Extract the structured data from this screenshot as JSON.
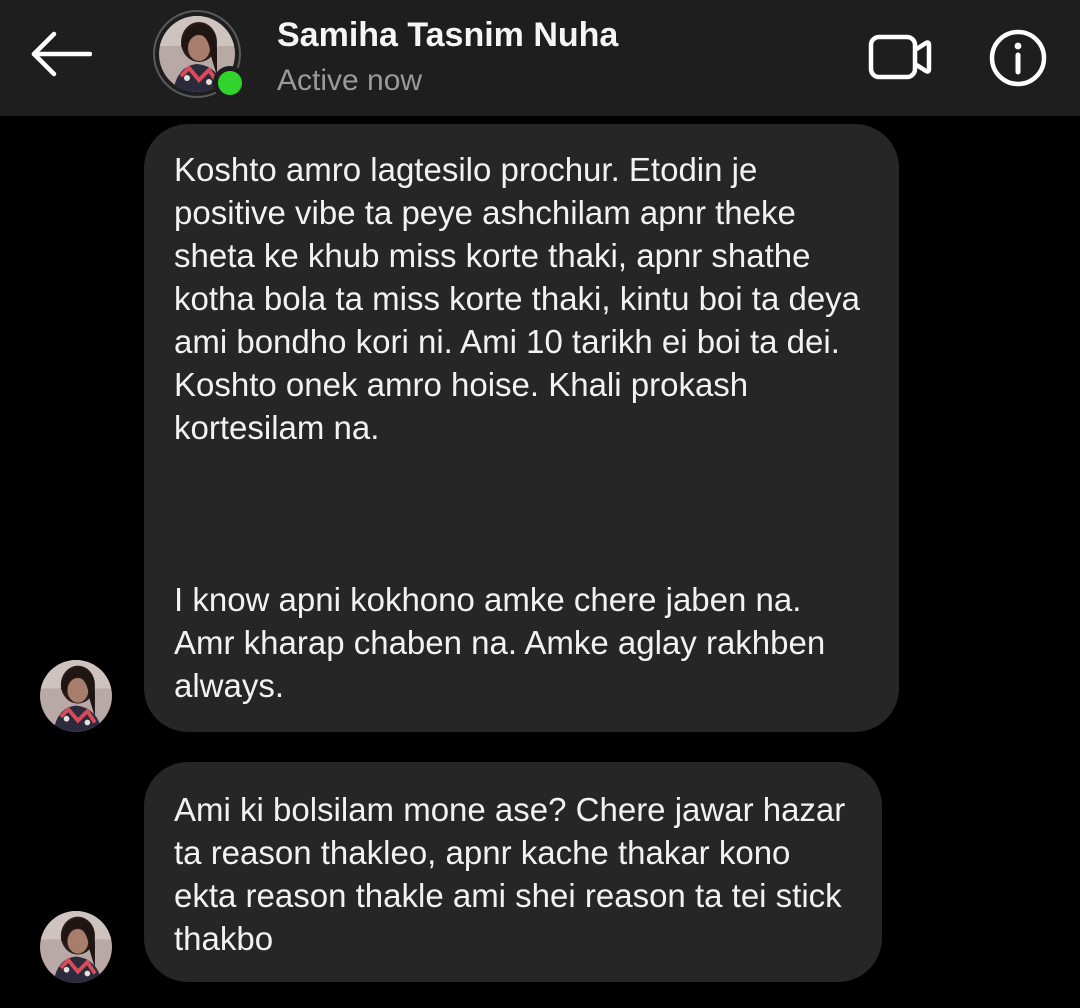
{
  "header": {
    "contact_name": "Samiha Tasnim Nuha",
    "status": "Active now",
    "online_color": "#31d42c",
    "icons": {
      "back": "back-arrow-icon",
      "video": "video-call-icon",
      "info": "info-icon"
    }
  },
  "messages": [
    {
      "sender": "Samiha Tasnim Nuha",
      "paragraphs": [
        "Koshto amro lagtesilo prochur. Etodin je positive vibe ta peye ashchilam apnr theke sheta ke khub miss korte thaki, apnr shathe kotha bola ta miss korte thaki, kintu boi ta deya ami bondho kori ni. Ami 10 tarikh ei boi ta dei. Koshto onek amro hoise. Khali prokash kortesilam na.",
        "I know apni kokhono amke chere jaben na. Amr kharap chaben na. Amke aglay rakhben always."
      ]
    },
    {
      "sender": "Samiha Tasnim Nuha",
      "paragraphs": [
        "Ami ki bolsilam mone ase? Chere jawar hazar ta reason thakleo, apnr kache thakar kono ekta reason thakle ami shei reason ta tei stick thakbo"
      ]
    }
  ],
  "colors": {
    "background": "#000000",
    "header_bg": "#1e1e1e",
    "bubble_bg": "#262626",
    "text": "#f2f2f2",
    "status_text": "#9a9a9a"
  }
}
